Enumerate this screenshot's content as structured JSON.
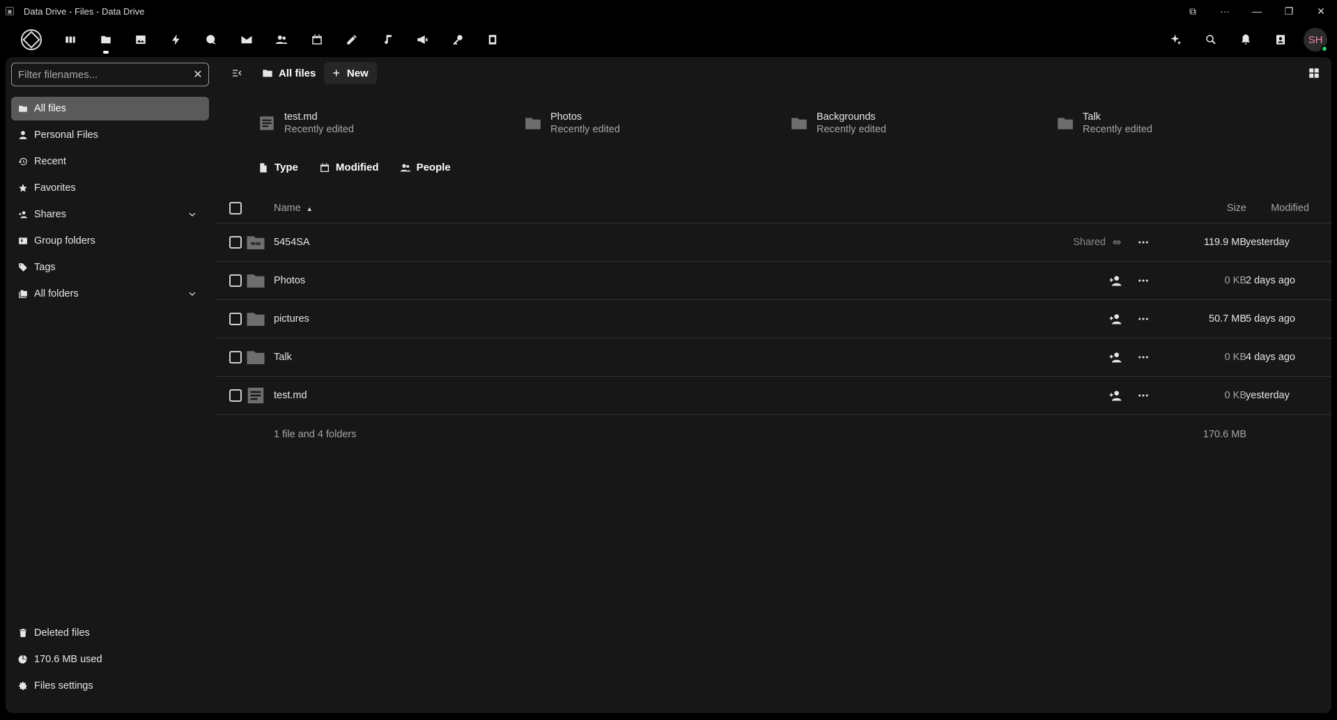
{
  "window": {
    "title": "Data Drive - Files - Data Drive"
  },
  "user": {
    "initials": "SH"
  },
  "sidebar": {
    "filter_placeholder": "Filter filenames...",
    "items": [
      {
        "label": "All files"
      },
      {
        "label": "Personal Files"
      },
      {
        "label": "Recent"
      },
      {
        "label": "Favorites"
      },
      {
        "label": "Shares"
      },
      {
        "label": "Group folders"
      },
      {
        "label": "Tags"
      },
      {
        "label": "All folders"
      }
    ],
    "bottom": [
      {
        "label": "Deleted files"
      },
      {
        "label": "170.6 MB used"
      },
      {
        "label": "Files settings"
      }
    ]
  },
  "breadcrumb": {
    "all_files": "All files",
    "new": "New"
  },
  "recent": [
    {
      "name": "test.md",
      "sub": "Recently edited"
    },
    {
      "name": "Photos",
      "sub": "Recently edited"
    },
    {
      "name": "Backgrounds",
      "sub": "Recently edited"
    },
    {
      "name": "Talk",
      "sub": "Recently edited"
    }
  ],
  "filters": {
    "type": "Type",
    "modified": "Modified",
    "people": "People"
  },
  "table": {
    "headers": {
      "name": "Name",
      "size": "Size",
      "modified": "Modified"
    },
    "rows": [
      {
        "name": "5454SA",
        "shared": "Shared",
        "size": "119.9 MB",
        "modified": "yesterday"
      },
      {
        "name": "Photos",
        "size": "0 KB",
        "modified": "2 days ago"
      },
      {
        "name": "pictures",
        "size": "50.7 MB",
        "modified": "5 days ago"
      },
      {
        "name": "Talk",
        "size": "0 KB",
        "modified": "4 days ago"
      },
      {
        "name": "test.md",
        "size": "0 KB",
        "modified": "yesterday"
      }
    ],
    "summary": {
      "count": "1 file and 4 folders",
      "total": "170.6 MB"
    }
  }
}
